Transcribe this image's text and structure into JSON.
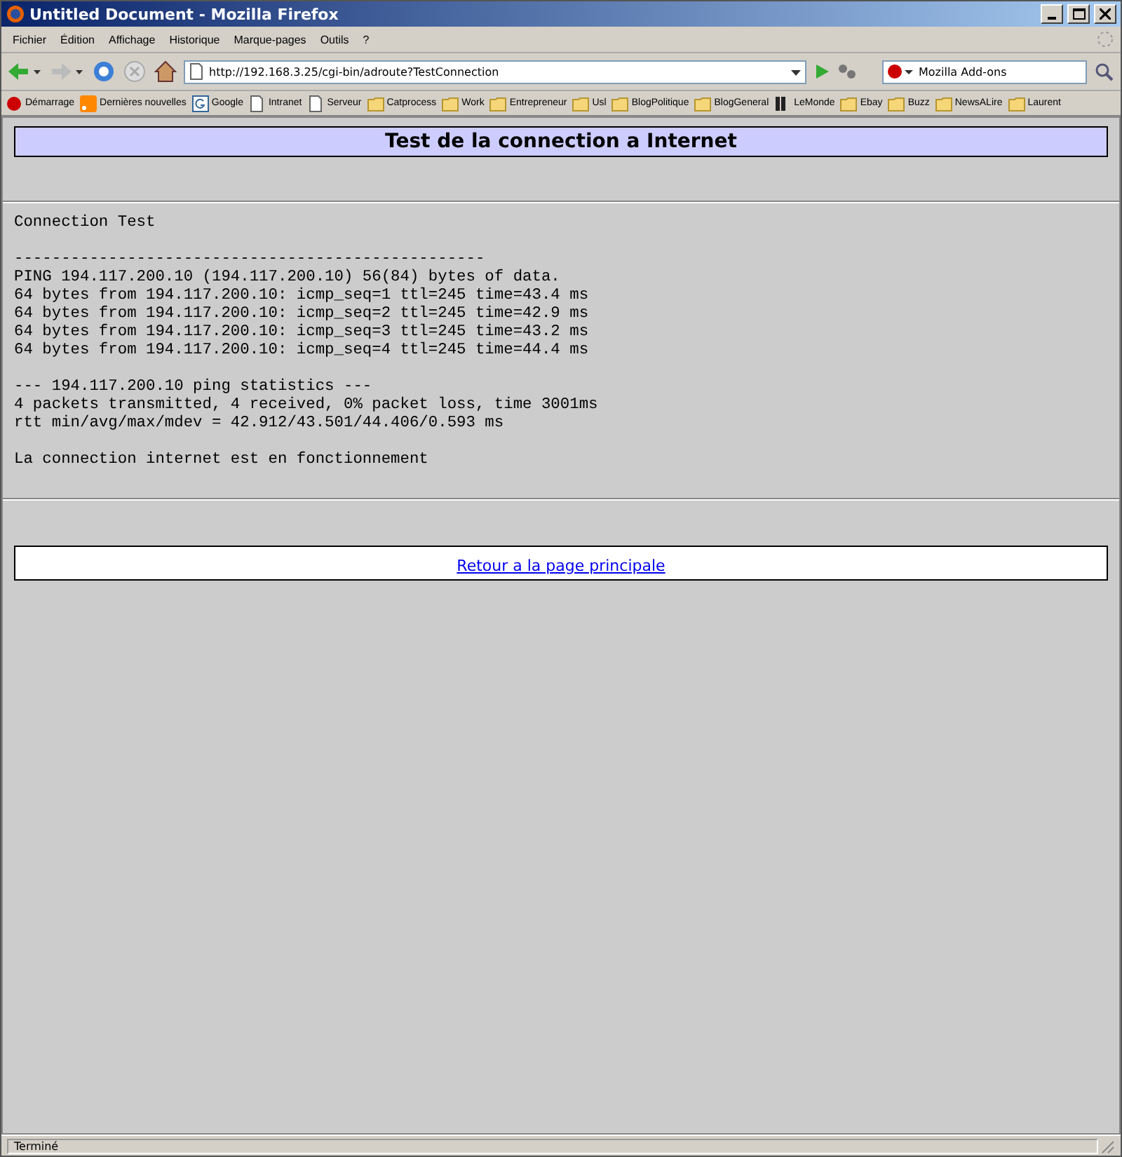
{
  "window": {
    "title": "Untitled Document - Mozilla Firefox"
  },
  "menu": [
    "Fichier",
    "Édition",
    "Affichage",
    "Historique",
    "Marque-pages",
    "Outils",
    "?"
  ],
  "address": {
    "value": "http://192.168.3.25/cgi-bin/adroute?TestConnection"
  },
  "search": {
    "value": "Mozilla Add-ons"
  },
  "bookmarks": [
    {
      "label": "Démarrage",
      "kind": "start"
    },
    {
      "label": "Dernières nouvelles",
      "kind": "feed"
    },
    {
      "label": "Google",
      "kind": "google"
    },
    {
      "label": "Intranet",
      "kind": "page"
    },
    {
      "label": "Serveur",
      "kind": "page"
    },
    {
      "label": "Catprocess",
      "kind": "folder"
    },
    {
      "label": "Work",
      "kind": "folder"
    },
    {
      "label": "Entrepreneur",
      "kind": "folder"
    },
    {
      "label": "Usl",
      "kind": "folder"
    },
    {
      "label": "BlogPolitique",
      "kind": "folder"
    },
    {
      "label": "BlogGeneral",
      "kind": "folder"
    },
    {
      "label": "LeMonde",
      "kind": "lemonde"
    },
    {
      "label": "Ebay",
      "kind": "folder"
    },
    {
      "label": "Buzz",
      "kind": "folder"
    },
    {
      "label": "NewsALire",
      "kind": "folder"
    },
    {
      "label": "Laurent",
      "kind": "folder"
    }
  ],
  "page": {
    "heading": "Test de la connection a Internet",
    "output": [
      [
        "Connection Test"
      ],
      [
        "--------------------------------------------------",
        "PING 194.117.200.10 (194.117.200.10) 56(84) bytes of data.",
        "64 bytes from 194.117.200.10: icmp_seq=1 ttl=245 time=43.4 ms",
        "64 bytes from 194.117.200.10: icmp_seq=2 ttl=245 time=42.9 ms",
        "64 bytes from 194.117.200.10: icmp_seq=3 ttl=245 time=43.2 ms",
        "64 bytes from 194.117.200.10: icmp_seq=4 ttl=245 time=44.4 ms"
      ],
      [
        "--- 194.117.200.10 ping statistics ---",
        "4 packets transmitted, 4 received, 0% packet loss, time 3001ms",
        "rtt min/avg/max/mdev = 42.912/43.501/44.406/0.593 ms"
      ],
      [
        "La connection internet est en fonctionnement"
      ]
    ],
    "link": "Retour a la page principale"
  },
  "status_bar": {
    "text": "Terminé"
  }
}
